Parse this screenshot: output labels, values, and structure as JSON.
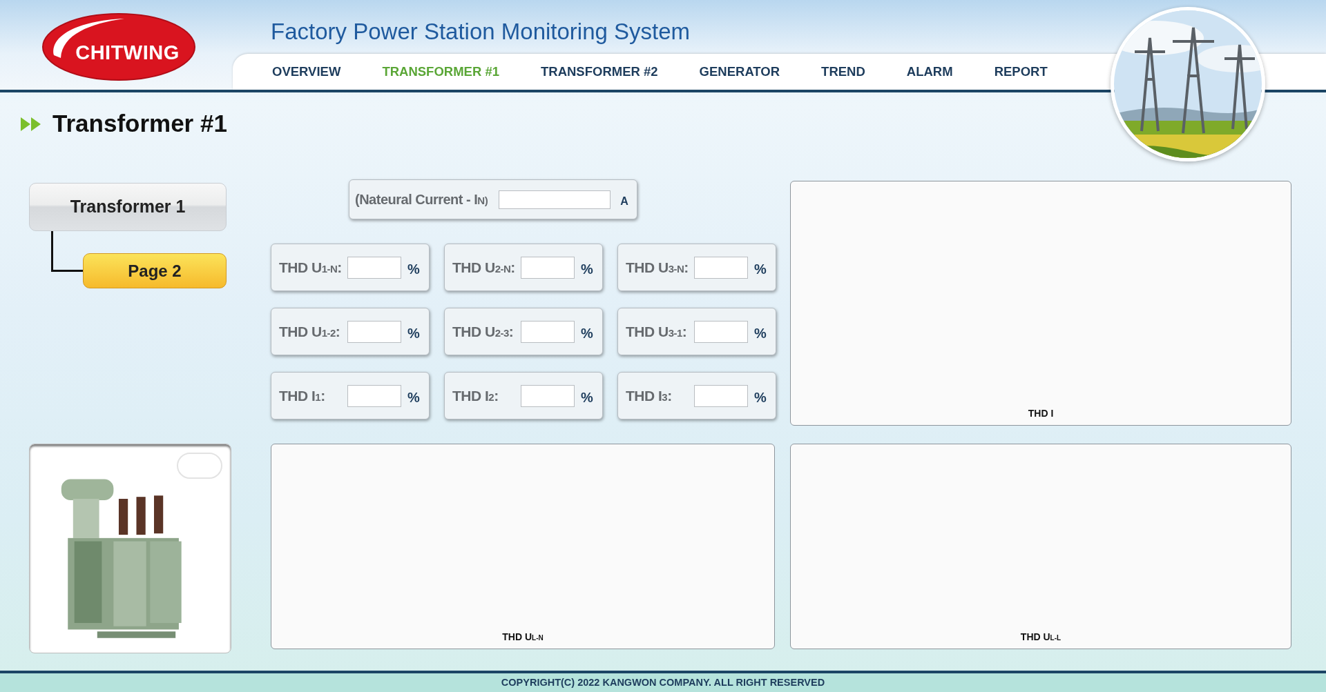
{
  "logo": {
    "text": "CHITWING"
  },
  "title": "Factory Power Station Monitoring System",
  "nav": [
    {
      "label": "OVERVIEW",
      "selected": false
    },
    {
      "label": "TRANSFORMER #1",
      "selected": true
    },
    {
      "label": "TRANSFORMER #2",
      "selected": false
    },
    {
      "label": "GENERATOR",
      "selected": false
    },
    {
      "label": "TREND",
      "selected": false
    },
    {
      "label": "ALARM",
      "selected": false
    },
    {
      "label": "REPORT",
      "selected": false
    }
  ],
  "page_title": "Transformer #1",
  "tree": [
    {
      "label": "Transformer 1",
      "selected": false,
      "children": [
        {
          "label": "Page 2",
          "selected": true
        }
      ]
    }
  ],
  "current_field": {
    "label": "(Nateural Current - I$_{N)}$",
    "unit": "A"
  },
  "thd_fields": [
    {
      "label": "THD U$_{1-N}$:",
      "unit": "%"
    },
    {
      "label": "THD U$_{2-N}$:",
      "unit": "%"
    },
    {
      "label": "THD U$_{3-N}$:",
      "unit": "%"
    },
    {
      "label": "THD U$_{1-2}$:",
      "unit": "%"
    },
    {
      "label": "THD U$_{2-3}$:",
      "unit": "%"
    },
    {
      "label": "THD U$_{3-1}$:",
      "unit": "%"
    },
    {
      "label": "THD I$_{1}$:",
      "unit": "%"
    },
    {
      "label": "THD I$_{2}$:",
      "unit": "%"
    },
    {
      "label": "THD I$_{3}$:",
      "unit": "%"
    }
  ],
  "charts": [
    {
      "label": "THD I"
    },
    {
      "label": "THD U$_{L-N}$"
    },
    {
      "label": "THD U$_{L-L}$"
    }
  ],
  "footer": "COPYRIGHT(C) 2022 KANGWON COMPANY. ALL RIGHT RESERVED"
}
